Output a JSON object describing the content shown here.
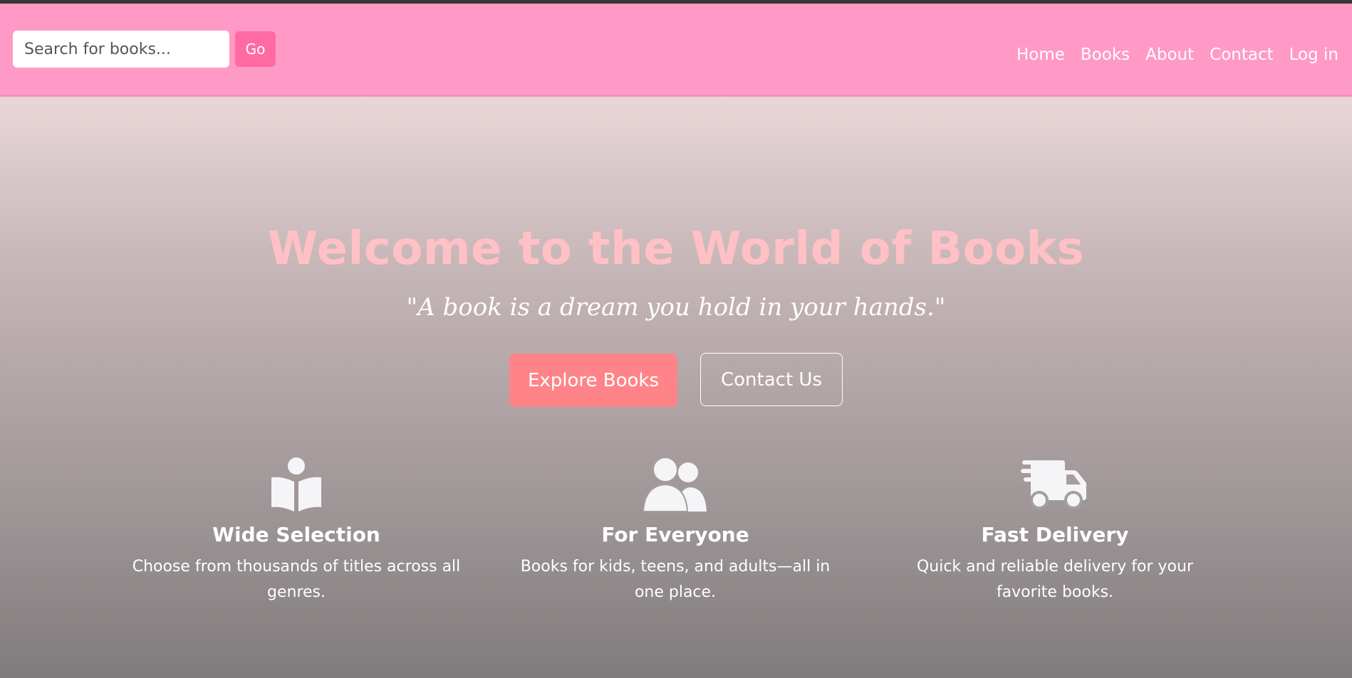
{
  "search": {
    "placeholder": "Search for books...",
    "button_label": "Go"
  },
  "nav": {
    "items": [
      "Home",
      "Books",
      "About",
      "Contact",
      "Log in"
    ]
  },
  "hero": {
    "title": "Welcome to the World of Books",
    "quote": "\"A book is a dream you hold in your hands.\"",
    "primary_button": "Explore Books",
    "secondary_button": "Contact Us"
  },
  "features": [
    {
      "icon": "book-reader-icon",
      "title": "Wide Selection",
      "text": "Choose from thousands of titles across all genres."
    },
    {
      "icon": "users-icon",
      "title": "For Everyone",
      "text": "Books for kids, teens, and adults—all in one place."
    },
    {
      "icon": "delivery-truck-icon",
      "title": "Fast Delivery",
      "text": "Quick and reliable delivery for your favorite books."
    }
  ],
  "colors": {
    "navbar": "#ff9ac6",
    "go_button": "#ff6aa2",
    "explore_button": "#ff8489",
    "hero_title": "#ffc0c6"
  }
}
